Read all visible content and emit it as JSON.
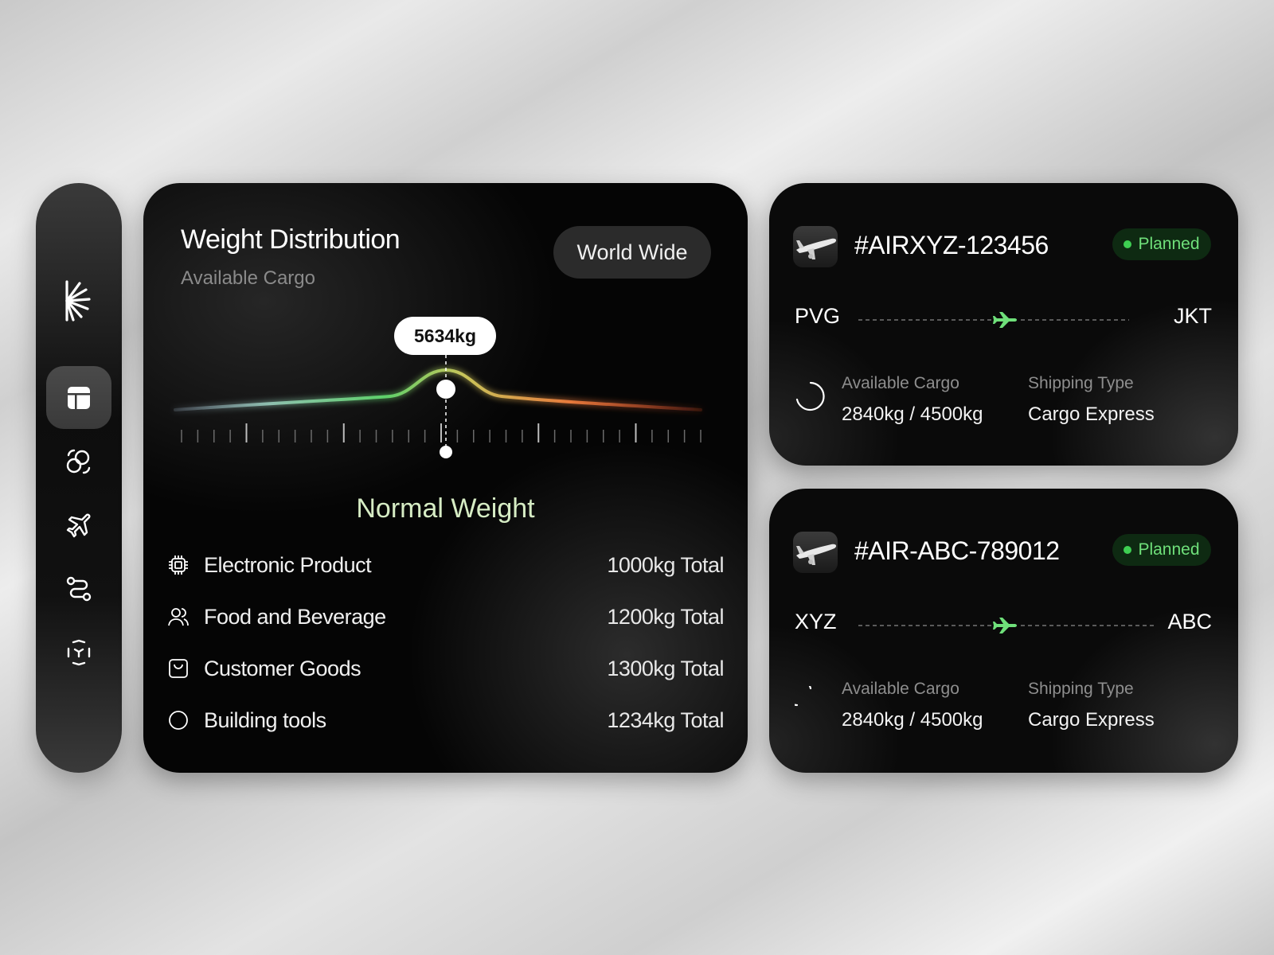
{
  "sidebar": {
    "items": [
      {
        "name": "dashboard",
        "icon": "layout-icon",
        "active": true
      },
      {
        "name": "exchange",
        "icon": "exchange-icon",
        "active": false
      },
      {
        "name": "flights",
        "icon": "plane-icon",
        "active": false
      },
      {
        "name": "routes",
        "icon": "route-icon",
        "active": false
      },
      {
        "name": "scan",
        "icon": "scan-box-icon",
        "active": false
      }
    ]
  },
  "weight": {
    "title": "Weight Distribution",
    "subtitle": "Available Cargo",
    "filter_label": "World Wide",
    "current_value": "5634kg",
    "status_label": "Normal Weight",
    "categories": [
      {
        "icon": "chip-icon",
        "label": "Electronic Product",
        "value": "1000kg Total"
      },
      {
        "icon": "users-icon",
        "label": "Food and Beverage",
        "value": "1200kg Total"
      },
      {
        "icon": "bag-icon",
        "label": "Customer Goods",
        "value": "1300kg Total"
      },
      {
        "icon": "circle-icon",
        "label": "Building tools",
        "value": "1234kg  Total"
      }
    ]
  },
  "flights": [
    {
      "id": "#AIRXYZ-123456",
      "status": "Planned",
      "from": "PVG",
      "to": "JKT",
      "cargo_label": "Available Cargo",
      "cargo_value": "2840kg / 4500kg",
      "shipping_label": "Shipping Type",
      "shipping_value": "Cargo Express"
    },
    {
      "id": "#AIR-ABC-789012",
      "status": "Planned",
      "from": "XYZ",
      "to": "ABC",
      "cargo_label": "Available Cargo",
      "cargo_value": "2840kg / 4500kg",
      "shipping_label": "Shipping Type",
      "shipping_value": "Cargo Express"
    }
  ],
  "colors": {
    "accent_green": "#3ecf52",
    "status_bg": "#0e2a12",
    "status_text": "#6fe07a",
    "normal_text": "#d6ecc4"
  }
}
